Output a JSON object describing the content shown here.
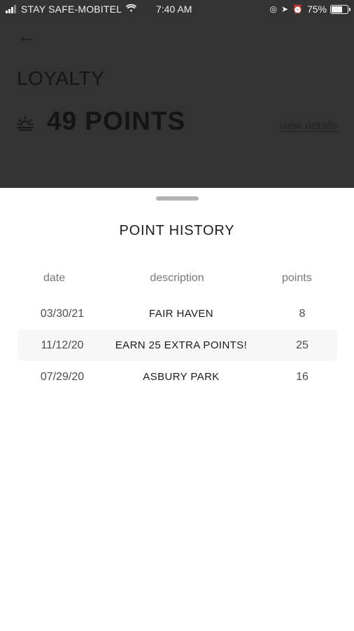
{
  "status_bar": {
    "carrier": "STAY SAFE-MOBITEL",
    "time": "7:40 AM",
    "battery": "75%",
    "battery_level": 0.75
  },
  "header": {
    "back_icon": "arrow-left-icon",
    "title": "LOYALTY",
    "points_icon": "sunrise-icon",
    "points": "49 POINTS",
    "view_details": "view details"
  },
  "sheet": {
    "title": "POINT HISTORY",
    "columns": {
      "date": "date",
      "description": "description",
      "points": "points"
    },
    "rows": [
      {
        "date": "03/30/21",
        "description": "FAIR HAVEN",
        "points": "8"
      },
      {
        "date": "11/12/20",
        "description": "EARN 25 EXTRA POINTS!",
        "points": "25"
      },
      {
        "date": "07/29/20",
        "description": "ASBURY PARK",
        "points": "16"
      }
    ]
  }
}
